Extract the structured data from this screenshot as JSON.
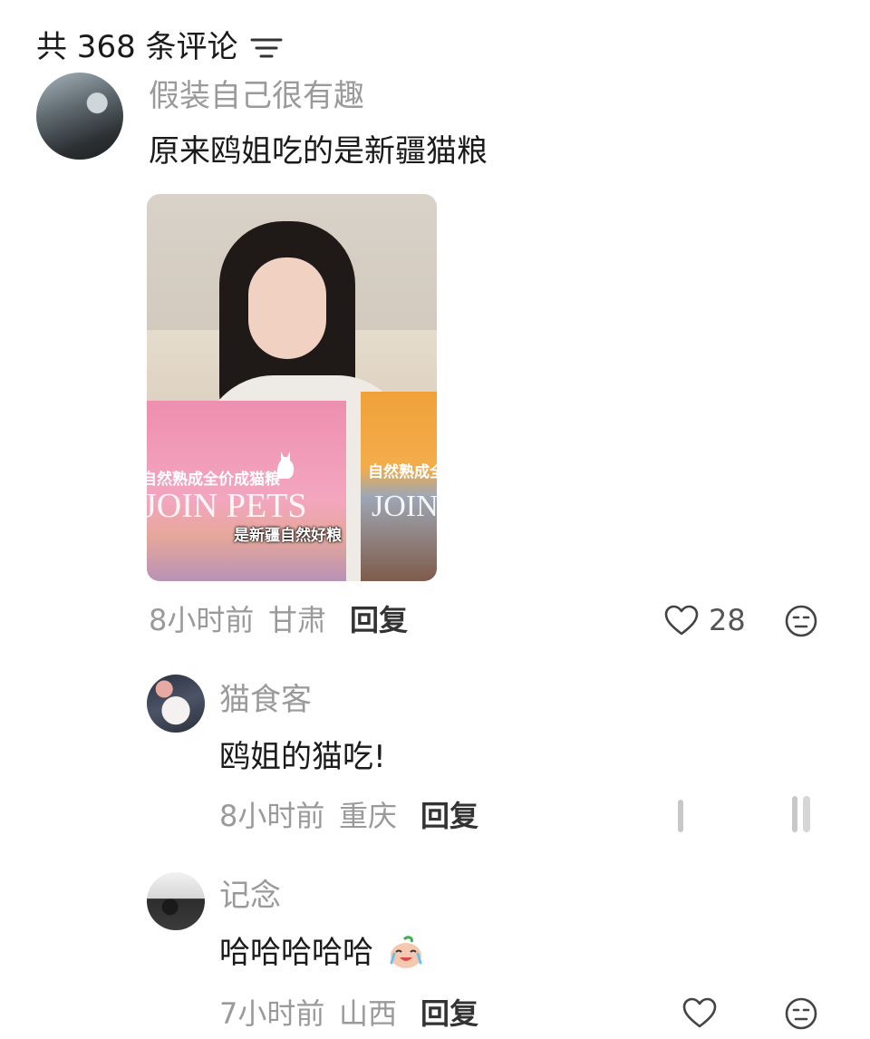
{
  "header": {
    "title": "共 368 条评论",
    "filter_icon": "filter-lines-icon"
  },
  "comments": [
    {
      "username": "假装自己很有趣",
      "text": "原来鸥姐吃的是新疆猫粮",
      "image": {
        "bag_left_brand": "JOIN PETS",
        "bag_left_title": "自然熟成全价成猫粮",
        "bag_right_brand": "JOIN",
        "bag_right_title": "自然熟成全价",
        "caption": "是新疆自然好粮"
      },
      "time": "8小时前",
      "location": "甘肃",
      "reply_label": "回复",
      "likes": "28"
    }
  ],
  "replies": [
    {
      "username": "猫食客",
      "text": "鸥姐的猫吃!",
      "time": "8小时前",
      "location": "重庆",
      "reply_label": "回复"
    },
    {
      "username": "记念",
      "text": "哈哈哈哈哈",
      "emoji": "crying-laughing-peach-sticker",
      "time": "7小时前",
      "location": "山西",
      "reply_label": "回复"
    }
  ],
  "colors": {
    "meta_gray": "#9a9a9a",
    "text": "#1a1a1a",
    "pink_bag": "#ee8fb0",
    "orange_bag": "#f1a13a"
  }
}
